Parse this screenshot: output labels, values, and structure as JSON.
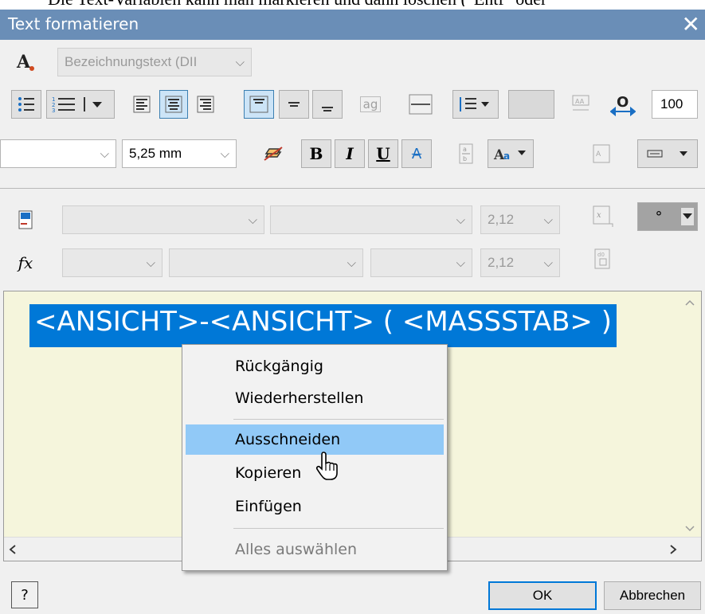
{
  "doc_snippet": "Die Text-Variablen kann man markieren und dann löschen (\"Entf\" oder",
  "window": {
    "title": "Text formatieren",
    "close_glyph": "✕"
  },
  "toolbar1": {
    "style_value": "Bezeichnungstext (DII"
  },
  "toolbar2": {
    "stretch_value": "100",
    "insert_glyph": "ag"
  },
  "toolbar3": {
    "font_value": "",
    "size_value": "5,25 mm",
    "bold": "B",
    "italic": "I",
    "underline": "U",
    "strike": "A"
  },
  "toolbar4": {
    "param_value1": "2,12",
    "symbol": "°"
  },
  "toolbar5": {
    "fx_label": "fx",
    "param_value2": "2,12"
  },
  "editor": {
    "selected_text": "<ANSICHT>-<ANSICHT> ( <MASSSTAB> )"
  },
  "context_menu": {
    "items": [
      {
        "label": "Rückgängig"
      },
      {
        "label": "Wiederherstellen"
      },
      {
        "label": "Ausschneiden"
      },
      {
        "label": "Kopieren"
      },
      {
        "label": "Einfügen"
      },
      {
        "label": "Alles auswählen"
      }
    ]
  },
  "footer": {
    "ok_label": "OK",
    "cancel_label": "Abbrechen",
    "help_glyph": "?"
  },
  "colors": {
    "titlebar": "#6a8eb7",
    "selection": "#0078d7",
    "editor_bg": "#f5f5dc",
    "menu_highlight": "#91c9f7"
  }
}
